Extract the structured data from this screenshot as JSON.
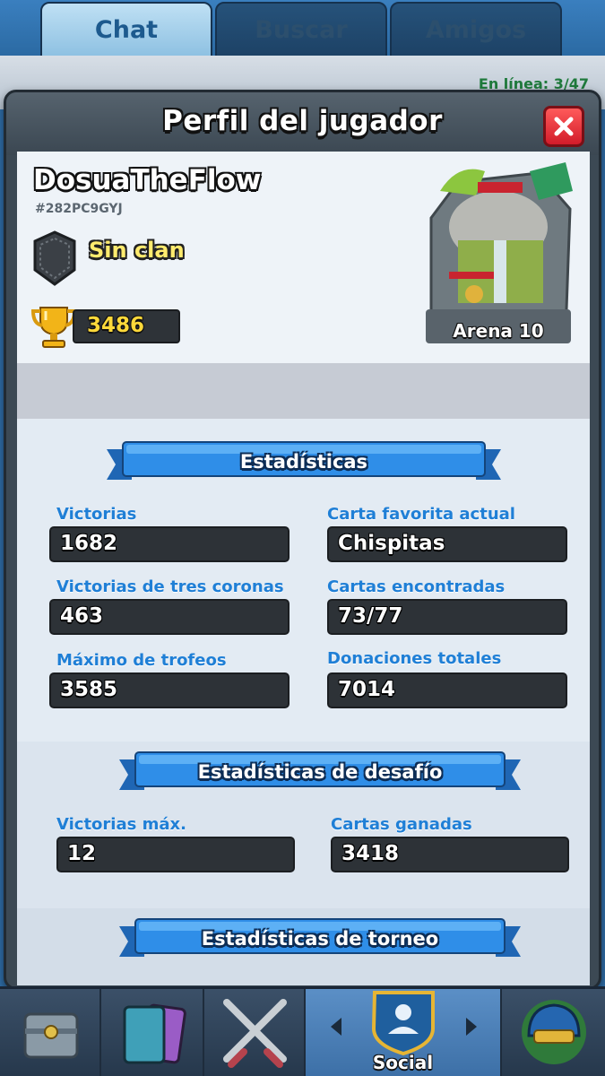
{
  "tabs": [
    {
      "label": "Chat"
    },
    {
      "label": "Buscar"
    },
    {
      "label": "Amigos"
    }
  ],
  "background": {
    "online_text": "En línea: 3/47"
  },
  "modal": {
    "title": "Perfil del jugador"
  },
  "player": {
    "name": "DosuaTheFlow",
    "tag": "#282PC9GYJ",
    "clan": "Sin clan",
    "trophies": "3486",
    "arena": "Arena 10"
  },
  "stats": {
    "header": "Estadísticas",
    "items": [
      {
        "label": "Victorias",
        "value": "1682"
      },
      {
        "label": "Carta favorita actual",
        "value": "Chispitas"
      },
      {
        "label": "Victorias de tres coronas",
        "value": "463"
      },
      {
        "label": "Cartas encontradas",
        "value": "73/77"
      },
      {
        "label": "Máximo de trofeos",
        "value": "3585"
      },
      {
        "label": "Donaciones totales",
        "value": "7014"
      }
    ]
  },
  "challenge": {
    "header": "Estadísticas de desafío",
    "items": [
      {
        "label": "Victorias máx.",
        "value": "12"
      },
      {
        "label": "Cartas ganadas",
        "value": "3418"
      }
    ]
  },
  "tournament": {
    "header": "Estadísticas de torneo"
  },
  "bottom_nav": {
    "active_label": "Social",
    "items": [
      "shop-chest-icon",
      "cards-icon",
      "crossed-swords-icon",
      "social-shield-icon",
      "tournament-helmet-icon"
    ]
  },
  "colors": {
    "stat_label": "#1f7fd6",
    "clan_text": "#ffeb6e",
    "trophy_text": "#ffd93a",
    "close_button": "#e02a36",
    "ribbon": "#2f8ee8"
  }
}
